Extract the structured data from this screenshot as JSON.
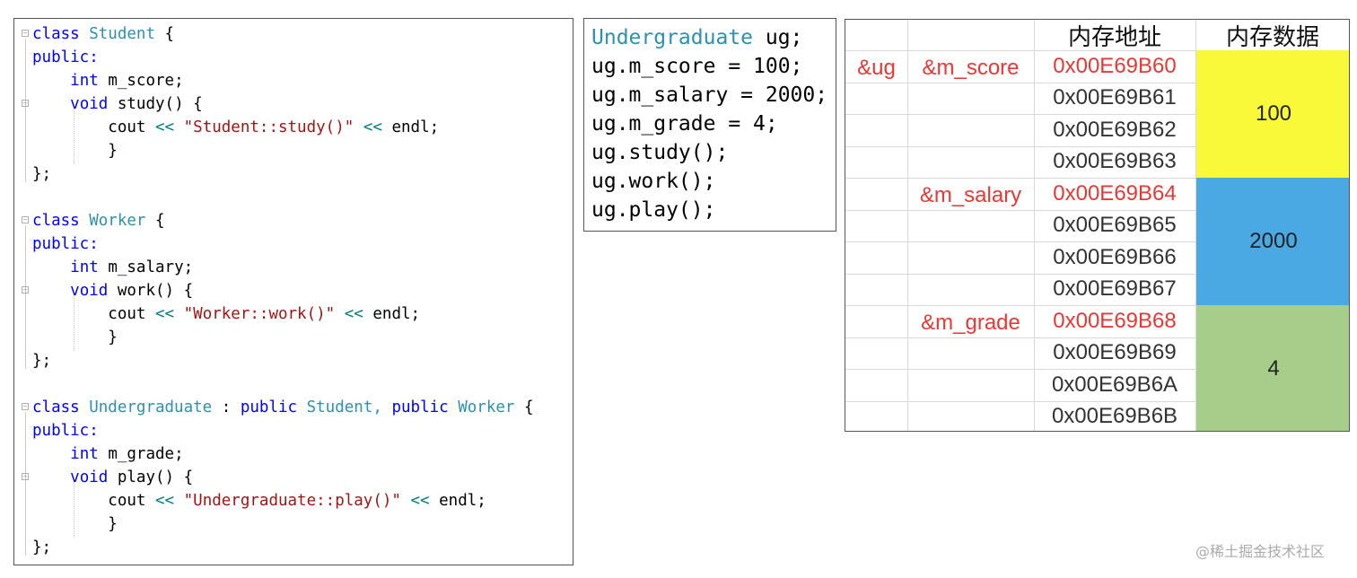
{
  "code_panel": {
    "lines": [
      [
        "class ",
        " Student",
        " {"
      ],
      [
        "public:"
      ],
      [
        "    ",
        "int",
        " m_score;"
      ],
      [
        "    ",
        "void",
        " study() {"
      ],
      [
        "        cout ",
        "<<",
        " ",
        "\"Student::study()\"",
        " ",
        "<<",
        " endl;"
      ],
      [
        "        }"
      ],
      [
        "};"
      ],
      [
        ""
      ],
      [
        "class ",
        " Worker",
        " {"
      ],
      [
        "public:"
      ],
      [
        "    ",
        "int",
        " m_salary;"
      ],
      [
        "    ",
        "void",
        " work() {"
      ],
      [
        "        cout ",
        "<<",
        " ",
        "\"Worker::work()\"",
        " ",
        "<<",
        " endl;"
      ],
      [
        "        }"
      ],
      [
        "};"
      ],
      [
        ""
      ],
      [
        "class ",
        " Undergraduate",
        " : ",
        "public",
        " ",
        "Student",
        ", ",
        "public",
        " ",
        "Worker",
        " {"
      ],
      [
        "public:"
      ],
      [
        "    ",
        "int",
        " m_grade;"
      ],
      [
        "    ",
        "void",
        " play() {"
      ],
      [
        "        cout ",
        "<<",
        " ",
        "\"Undergraduate::play()\"",
        " ",
        "<<",
        " endl;"
      ],
      [
        "        }"
      ],
      [
        "};"
      ]
    ]
  },
  "code_text": {
    "l1a": "class",
    "l1b": "Student",
    "l1c": "{",
    "l2": "public:",
    "l3a": "int",
    "l3b": "m_score;",
    "l4a": "void",
    "l4b": "study() {",
    "l5a": "cout",
    "l5b": "<<",
    "l5c": "\"Student::study()\"",
    "l5d": "<<",
    "l5e": "endl;",
    "l6": "}",
    "l7": "};",
    "l9a": "class",
    "l9b": "Worker",
    "l9c": "{",
    "l10": "public:",
    "l11a": "int",
    "l11b": "m_salary;",
    "l12a": "void",
    "l12b": "work() {",
    "l13a": "cout",
    "l13b": "<<",
    "l13c": "\"Worker::work()\"",
    "l13d": "<<",
    "l13e": "endl;",
    "l14": "}",
    "l15": "};",
    "l17a": "class",
    "l17b": "Undergraduate",
    "l17c": ":",
    "l17d": "public",
    "l17e": "Student,",
    "l17f": "public",
    "l17g": "Worker",
    "l17h": "{",
    "l18": "public:",
    "l19a": "int",
    "l19b": "m_grade;",
    "l20a": "void",
    "l20b": "play() {",
    "l21a": "cout",
    "l21b": "<<",
    "l21c": "\"Undergraduate::play()\"",
    "l21d": "<<",
    "l21e": "endl;",
    "l22": "}",
    "l23": "};"
  },
  "snippet": {
    "l1a": "Undergraduate",
    "l1b": " ug;",
    "l2": "ug.m_score = 100;",
    "l3": "ug.m_salary = 2000;",
    "l4": "ug.m_grade = 4;",
    "l5": "ug.study();",
    "l6": "ug.work();",
    "l7": "ug.play();"
  },
  "memory_table": {
    "header_address": "内存地址",
    "header_data": "内存数据",
    "object_label": "&ug",
    "field_labels": [
      "&m_score",
      "&m_salary",
      "&m_grade"
    ],
    "addresses": [
      "0x00E69B60",
      "0x00E69B61",
      "0x00E69B62",
      "0x00E69B63",
      "0x00E69B64",
      "0x00E69B65",
      "0x00E69B66",
      "0x00E69B67",
      "0x00E69B68",
      "0x00E69B69",
      "0x00E69B6A",
      "0x00E69B6B"
    ],
    "values": [
      "100",
      "2000",
      "4"
    ],
    "value_colors": [
      "#f9f93a",
      "#4aa8e3",
      "#a7cd8a"
    ],
    "highlight_color": "#e53935"
  },
  "watermark": "@稀土掘金技术社区"
}
